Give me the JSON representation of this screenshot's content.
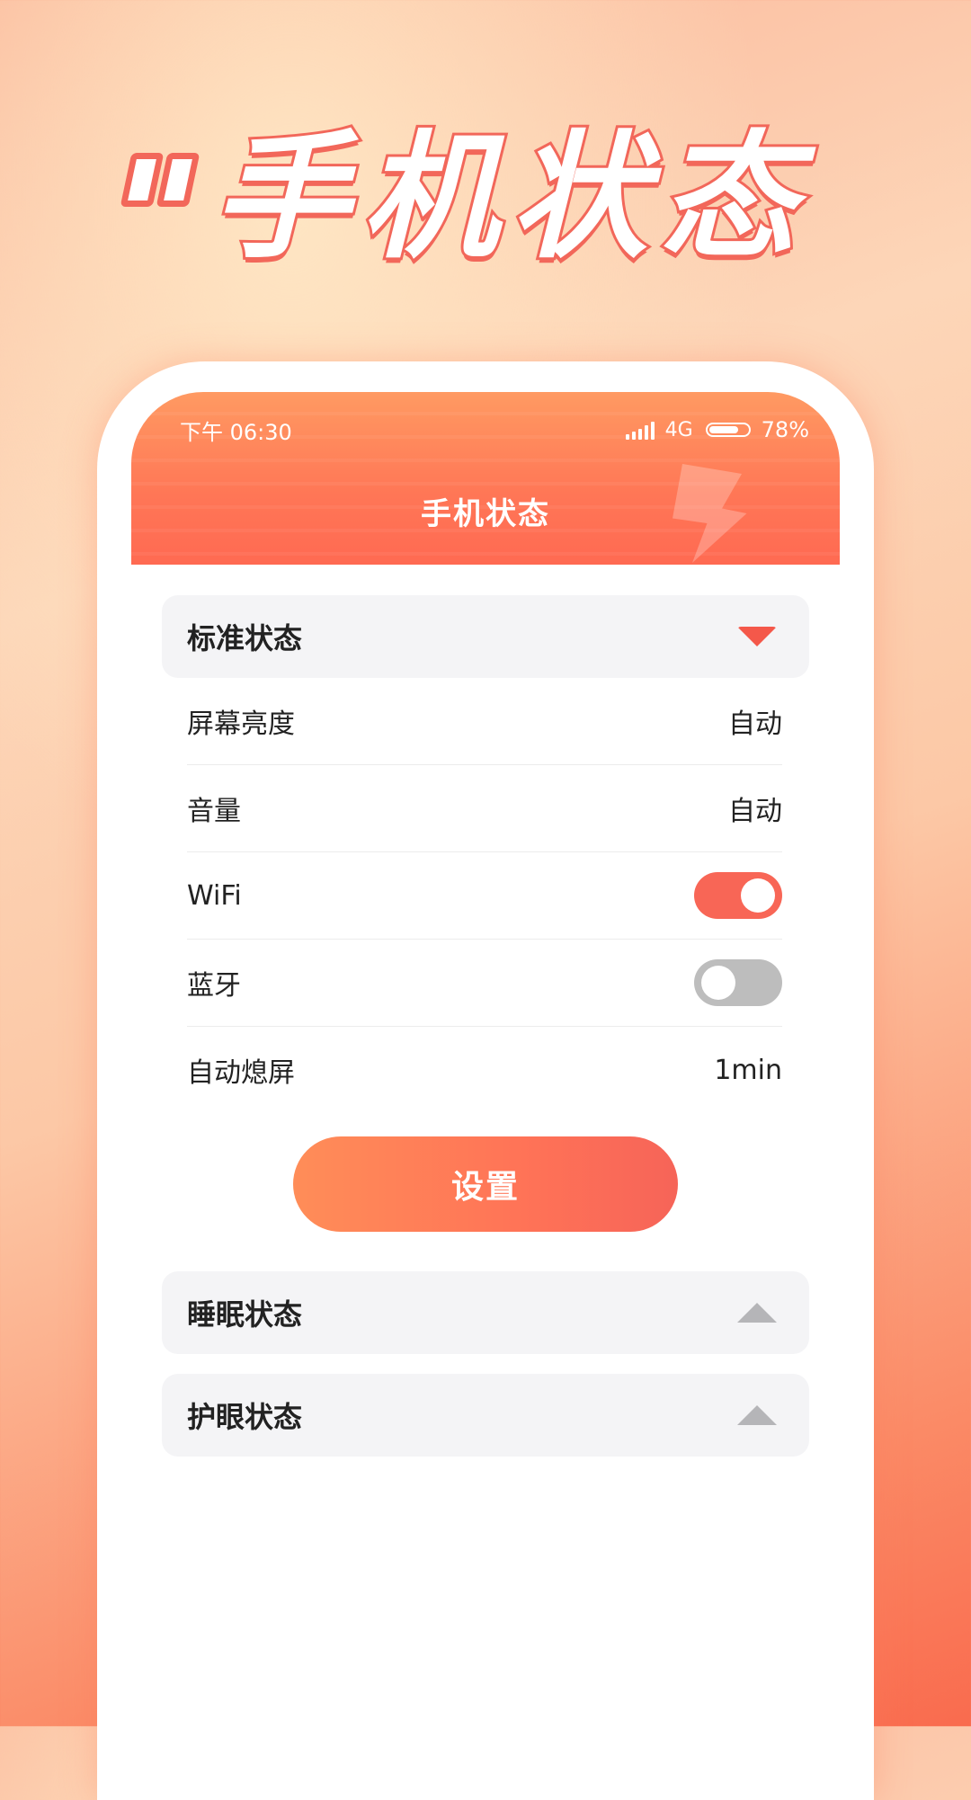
{
  "hero": {
    "title": "手机状态"
  },
  "status_bar": {
    "time": "下午 06:30",
    "network": "4G",
    "battery": "78%",
    "battery_level": 0.78
  },
  "header": {
    "title": "手机状态"
  },
  "sections": {
    "standard": {
      "title": "标准状态",
      "rows": [
        {
          "label": "屏幕亮度",
          "value": "自动"
        },
        {
          "label": "音量",
          "value": "自动"
        },
        {
          "label": "WiFi",
          "toggle": true
        },
        {
          "label": "蓝牙",
          "toggle": false
        },
        {
          "label": "自动熄屏",
          "value": "1min"
        }
      ],
      "button": "设置"
    },
    "sleep": {
      "title": "睡眠状态"
    },
    "eye": {
      "title": "护眼状态"
    }
  },
  "colors": {
    "accent": "#f86656",
    "header_top": "#ff9a62",
    "header_bottom": "#ff6a52"
  },
  "icons": [
    "signal-icon",
    "battery-icon",
    "chevron-down-icon",
    "chevron-up-icon",
    "lightning-icon"
  ]
}
